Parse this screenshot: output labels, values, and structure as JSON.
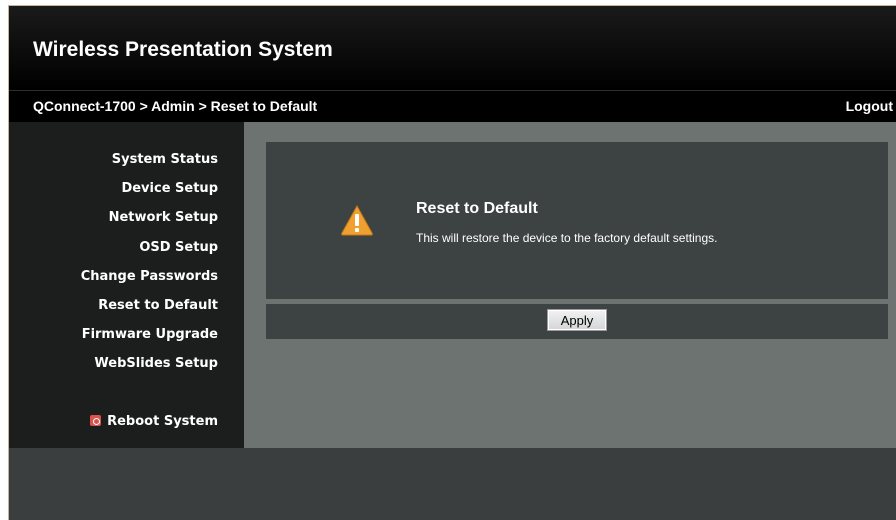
{
  "header": {
    "title": "Wireless Presentation System"
  },
  "breadcrumb": {
    "path": "QConnect-1700 > Admin > Reset to Default",
    "logout_label": "Logout"
  },
  "sidebar": {
    "items": [
      {
        "label": "System Status"
      },
      {
        "label": "Device Setup"
      },
      {
        "label": "Network Setup"
      },
      {
        "label": "OSD Setup"
      },
      {
        "label": "Change Passwords"
      },
      {
        "label": "Reset to Default"
      },
      {
        "label": "Firmware Upgrade"
      },
      {
        "label": "WebSlides Setup"
      }
    ],
    "reboot": {
      "label": "Reboot System",
      "icon": "power-icon"
    }
  },
  "main": {
    "panel": {
      "icon": "warning-icon",
      "title": "Reset to Default",
      "description": "This will restore the device to the factory default settings."
    },
    "apply_label": "Apply"
  },
  "colors": {
    "accent_warning": "#f0a030",
    "reboot_icon": "#d9534f"
  }
}
